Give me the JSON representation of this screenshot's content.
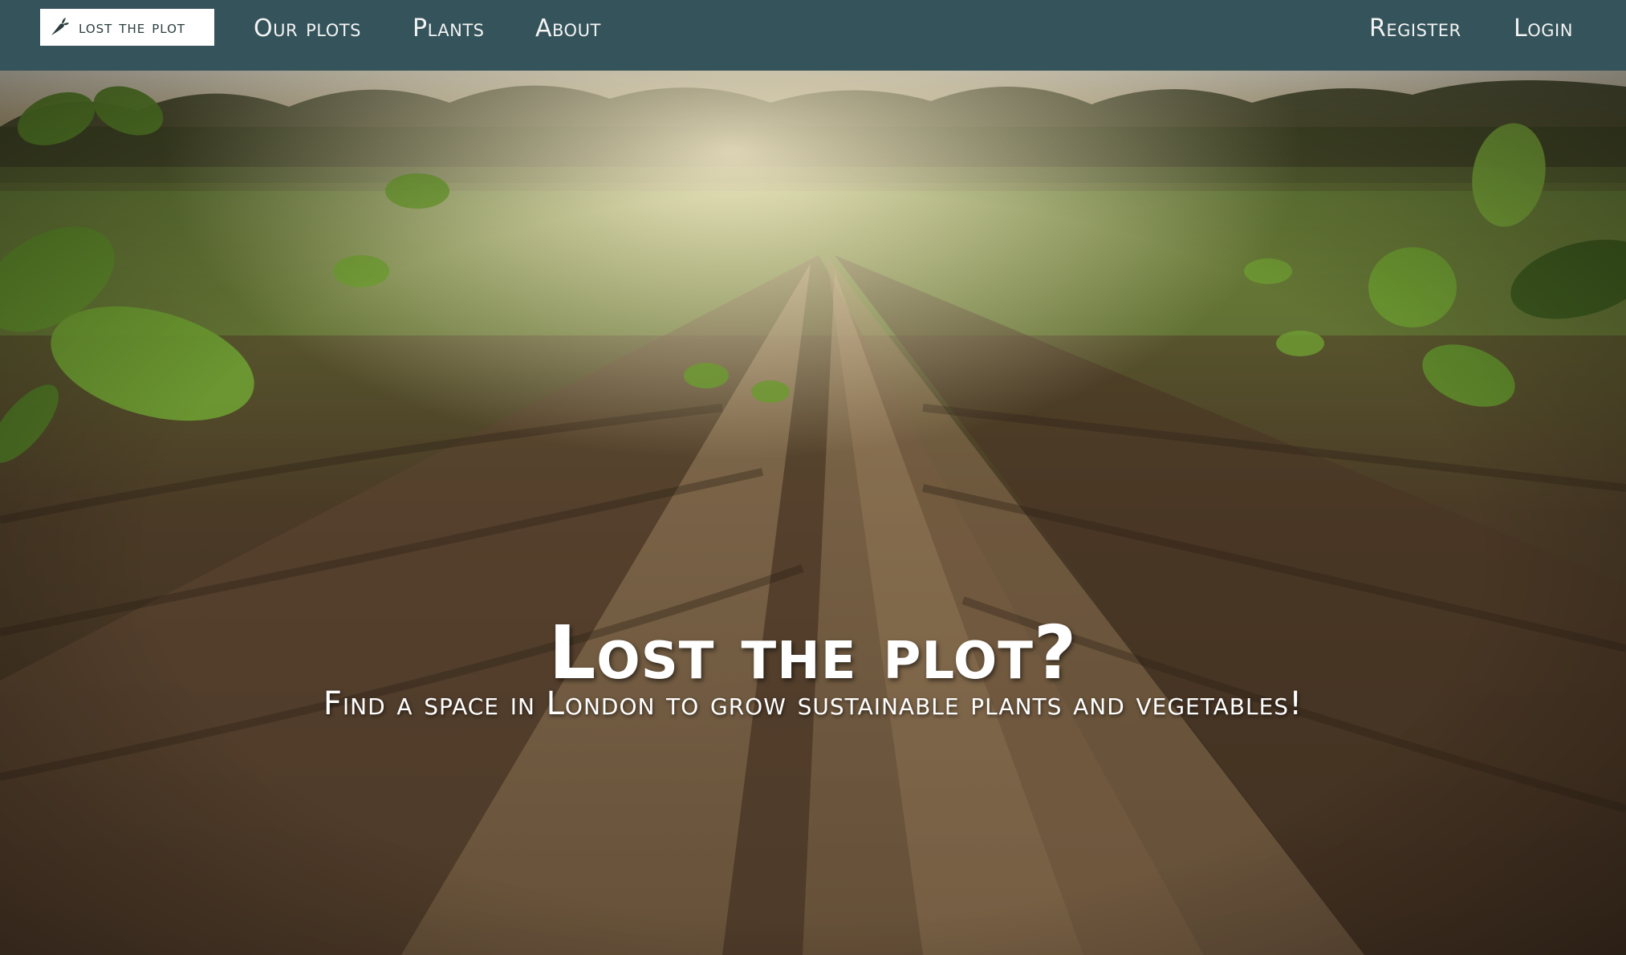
{
  "navbar": {
    "brand": {
      "label": "Lost the plot",
      "icon": "carrot-icon"
    },
    "links": [
      {
        "label": "Our plots"
      },
      {
        "label": "Plants"
      },
      {
        "label": "About"
      }
    ],
    "auth": {
      "register_label": "Register",
      "login_label": "Login"
    },
    "background_color": "#34535a"
  },
  "hero": {
    "title": "Lost the plot?",
    "subtitle": "Find a space in London to grow sustainable plants and vegetables!",
    "image": "field-rows-of-plants-photo"
  }
}
